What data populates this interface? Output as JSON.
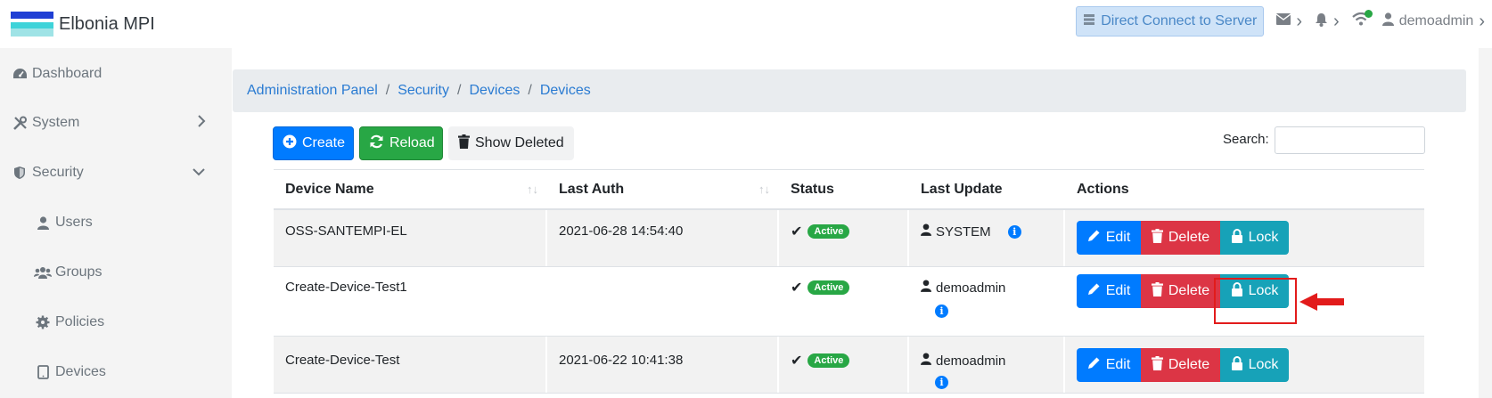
{
  "app": {
    "title": "Elbonia MPI"
  },
  "topbar": {
    "direct_connect": "Direct Connect to Server",
    "user": "demoadmin",
    "icons": [
      "server-icon",
      "envelope-icon",
      "bell-icon",
      "wifi-icon",
      "user-icon"
    ]
  },
  "sidebar": {
    "items": [
      {
        "label": "Dashboard",
        "icon": "dashboard-icon"
      },
      {
        "label": "System",
        "icon": "tools-icon"
      },
      {
        "label": "Security",
        "icon": "shield-icon"
      },
      {
        "label": "Users",
        "icon": "user-icon"
      },
      {
        "label": "Groups",
        "icon": "users-icon"
      },
      {
        "label": "Policies",
        "icon": "cog-icon"
      },
      {
        "label": "Devices",
        "icon": "tablet-icon"
      }
    ]
  },
  "breadcrumb": [
    "Administration Panel",
    "Security",
    "Devices",
    "Devices"
  ],
  "toolbar": {
    "create": "Create",
    "reload": "Reload",
    "show_deleted": "Show Deleted",
    "search_label": "Search:",
    "search_value": ""
  },
  "table": {
    "headers": [
      "Device Name",
      "Last Auth",
      "Status",
      "Last Update",
      "Actions"
    ],
    "rows": [
      {
        "name": "OSS-SANTEMPI-EL",
        "last_auth": "2021-06-28 14:54:40",
        "status": "Active",
        "updated_by": "SYSTEM"
      },
      {
        "name": "Create-Device-Test1",
        "last_auth": "",
        "status": "Active",
        "updated_by": "demoadmin"
      },
      {
        "name": "Create-Device-Test",
        "last_auth": "2021-06-22 10:41:38",
        "status": "Active",
        "updated_by": "demoadmin"
      }
    ],
    "actions": {
      "edit": "Edit",
      "delete": "Delete",
      "lock": "Lock"
    }
  },
  "colors": {
    "primary": "#007bff",
    "success": "#28a745",
    "danger": "#dc3545",
    "info": "#17a2b8",
    "annotation": "#e21b1b"
  }
}
